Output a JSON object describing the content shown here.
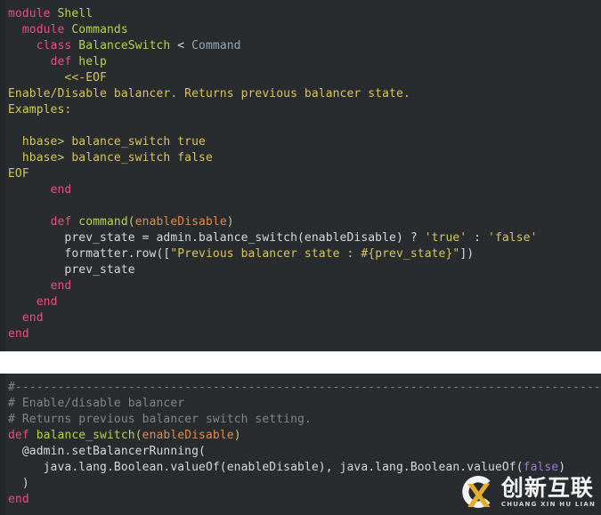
{
  "panels": [
    {
      "name": "ruby-shell-command-source",
      "background": "#282c2f",
      "lines": [
        [
          {
            "t": "module",
            "c": "t-kw"
          },
          {
            "t": " ",
            "c": "t-plain"
          },
          {
            "t": "Shell",
            "c": "t-type"
          }
        ],
        [
          {
            "t": "  ",
            "c": "t-plain"
          },
          {
            "t": "module",
            "c": "t-kw"
          },
          {
            "t": " ",
            "c": "t-plain"
          },
          {
            "t": "Commands",
            "c": "t-type"
          }
        ],
        [
          {
            "t": "    ",
            "c": "t-plain"
          },
          {
            "t": "class",
            "c": "t-kw"
          },
          {
            "t": " ",
            "c": "t-plain"
          },
          {
            "t": "BalanceSwitch",
            "c": "t-type"
          },
          {
            "t": " < ",
            "c": "t-plain"
          },
          {
            "t": "Command",
            "c": "t-const"
          }
        ],
        [
          {
            "t": "      ",
            "c": "t-plain"
          },
          {
            "t": "def",
            "c": "t-kw"
          },
          {
            "t": " ",
            "c": "t-plain"
          },
          {
            "t": "help",
            "c": "t-type"
          }
        ],
        [
          {
            "t": "        ",
            "c": "t-plain"
          },
          {
            "t": "<<-EOF",
            "c": "t-str"
          }
        ],
        [
          {
            "t": "Enable/Disable balancer. Returns previous balancer state.",
            "c": "t-str"
          }
        ],
        [
          {
            "t": "Examples:",
            "c": "t-str"
          }
        ],
        [
          {
            "t": "",
            "c": "t-str"
          }
        ],
        [
          {
            "t": "  hbase> balance_switch true",
            "c": "t-str"
          }
        ],
        [
          {
            "t": "  hbase> balance_switch false",
            "c": "t-str"
          }
        ],
        [
          {
            "t": "EOF",
            "c": "t-str"
          }
        ],
        [
          {
            "t": "      ",
            "c": "t-plain"
          },
          {
            "t": "end",
            "c": "t-kw"
          }
        ],
        [
          {
            "t": "",
            "c": "t-plain"
          }
        ],
        [
          {
            "t": "      ",
            "c": "t-plain"
          },
          {
            "t": "def",
            "c": "t-kw"
          },
          {
            "t": " ",
            "c": "t-plain"
          },
          {
            "t": "command",
            "c": "t-type"
          },
          {
            "t": "(",
            "c": "t-punct"
          },
          {
            "t": "enableDisable",
            "c": "t-param"
          },
          {
            "t": ")",
            "c": "t-punct"
          }
        ],
        [
          {
            "t": "        prev_state = admin.balance_switch(enableDisable) ? ",
            "c": "t-plain"
          },
          {
            "t": "'true'",
            "c": "t-str"
          },
          {
            "t": " : ",
            "c": "t-plain"
          },
          {
            "t": "'false'",
            "c": "t-str"
          }
        ],
        [
          {
            "t": "        formatter.row([",
            "c": "t-plain"
          },
          {
            "t": "\"Previous balancer state : #{prev_state}\"",
            "c": "t-str"
          },
          {
            "t": "])",
            "c": "t-plain"
          }
        ],
        [
          {
            "t": "        prev_state",
            "c": "t-plain"
          }
        ],
        [
          {
            "t": "      ",
            "c": "t-plain"
          },
          {
            "t": "end",
            "c": "t-kw"
          }
        ],
        [
          {
            "t": "    ",
            "c": "t-plain"
          },
          {
            "t": "end",
            "c": "t-kw"
          }
        ],
        [
          {
            "t": "  ",
            "c": "t-plain"
          },
          {
            "t": "end",
            "c": "t-kw"
          }
        ],
        [
          {
            "t": "end",
            "c": "t-kw"
          }
        ]
      ]
    },
    {
      "name": "ruby-admin-balance-switch-source",
      "background": "#282c2f",
      "lines": [
        [
          {
            "t": "#----------------------------------------------------------------------------------------------",
            "c": "t-comment"
          }
        ],
        [
          {
            "t": "# Enable/disable balancer",
            "c": "t-comment"
          }
        ],
        [
          {
            "t": "# Returns previous balancer switch setting.",
            "c": "t-comment"
          }
        ],
        [
          {
            "t": "def",
            "c": "t-kw"
          },
          {
            "t": " ",
            "c": "t-plain"
          },
          {
            "t": "balance_switch",
            "c": "t-type"
          },
          {
            "t": "(",
            "c": "t-punct"
          },
          {
            "t": "enableDisable",
            "c": "t-param"
          },
          {
            "t": ")",
            "c": "t-punct"
          }
        ],
        [
          {
            "t": "  @admin.setBalancerRunning(",
            "c": "t-plain"
          }
        ],
        [
          {
            "t": "     java.lang.Boolean.valueOf(enableDisable), java.lang.Boolean.valueOf(",
            "c": "t-plain"
          },
          {
            "t": "false",
            "c": "t-bool"
          },
          {
            "t": ")",
            "c": "t-plain"
          }
        ],
        [
          {
            "t": "  )",
            "c": "t-plain"
          }
        ],
        [
          {
            "t": "end",
            "c": "t-kw"
          }
        ]
      ]
    }
  ],
  "watermark": {
    "logo_letter": "X",
    "chinese_text": "创新互联",
    "pinyin_text": "CHUANG XIN HU LIAN",
    "accent_color": "#f0b429"
  }
}
